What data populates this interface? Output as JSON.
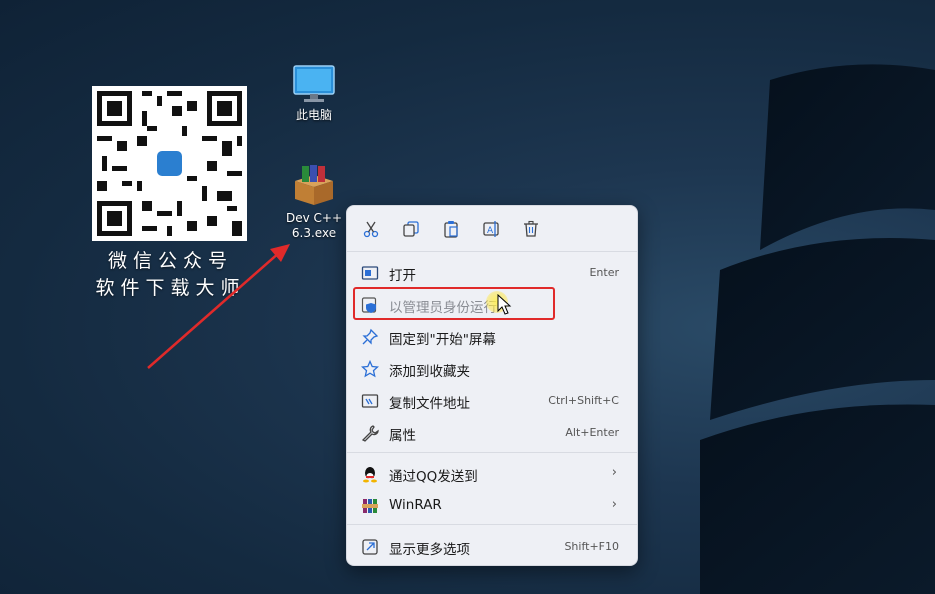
{
  "desktop": {
    "icons": [
      {
        "label": "此电脑",
        "icon": "monitor-icon"
      },
      {
        "label_line1": "Dev C++",
        "label_line2": "6.3.exe",
        "icon": "winrar-package-icon"
      }
    ],
    "qr_caption_line1": "微信公众号",
    "qr_caption_line2": "软件下载大师"
  },
  "context_menu": {
    "toolbar": [
      "cut-icon",
      "copy-icon",
      "paste-icon",
      "rename-icon",
      "delete-icon"
    ],
    "items": [
      {
        "label": "打开",
        "shortcut": "Enter",
        "icon": "open-icon"
      },
      {
        "label": "以管理员身份运行",
        "shortcut": "",
        "icon": "shield-icon"
      },
      {
        "label": "固定到\"开始\"屏幕",
        "shortcut": "",
        "icon": "pin-icon"
      },
      {
        "label": "添加到收藏夹",
        "shortcut": "",
        "icon": "star-icon"
      },
      {
        "label": "复制文件地址",
        "shortcut": "Ctrl+Shift+C",
        "icon": "copy-path-icon"
      },
      {
        "label": "属性",
        "shortcut": "Alt+Enter",
        "icon": "wrench-icon"
      },
      {
        "label": "通过QQ发送到",
        "shortcut": "",
        "icon": "qq-icon",
        "submenu": true
      },
      {
        "label": "WinRAR",
        "shortcut": "",
        "icon": "winrar-icon",
        "submenu": true
      },
      {
        "label": "显示更多选项",
        "shortcut": "Shift+F10",
        "icon": "more-options-icon"
      }
    ]
  },
  "colors": {
    "accent": "#2b6fd6",
    "highlight_border": "#e02a2a",
    "arrow": "#e02a2a"
  }
}
